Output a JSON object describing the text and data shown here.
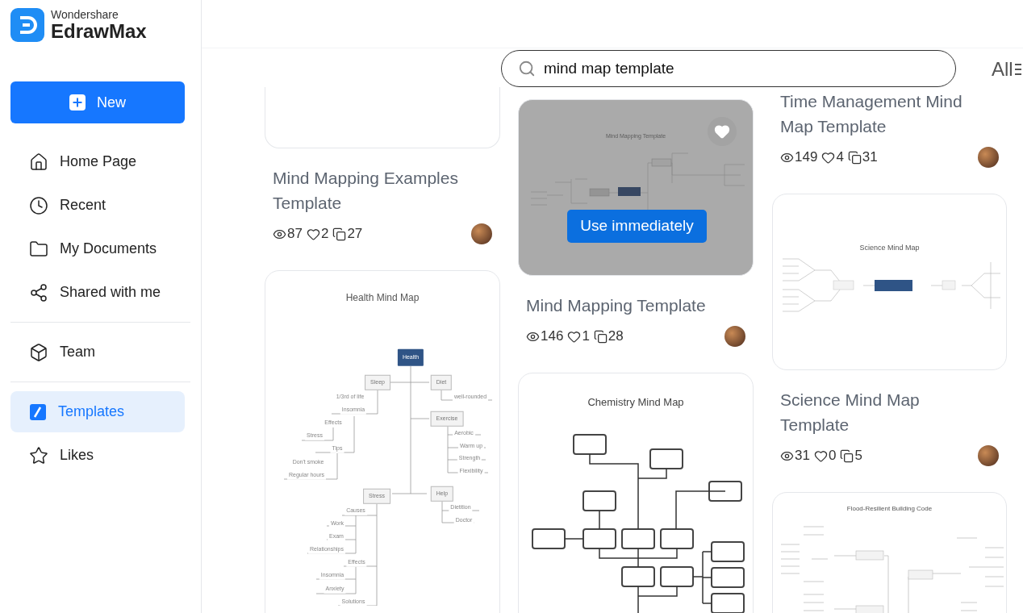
{
  "app": {
    "brand": "Wondershare",
    "product": "EdrawMax"
  },
  "sidebar": {
    "new_button": "New",
    "sections": [
      [
        {
          "label": "Home Page",
          "selected": false
        },
        {
          "label": "Recent",
          "selected": false
        },
        {
          "label": "My Documents",
          "selected": false
        },
        {
          "label": "Shared with me",
          "selected": false
        }
      ],
      [
        {
          "label": "Team",
          "selected": false
        }
      ],
      [
        {
          "label": "Templates",
          "selected": true
        },
        {
          "label": "Likes",
          "selected": false
        }
      ]
    ]
  },
  "search": {
    "value": "mind map template"
  },
  "filter": {
    "label": "All"
  },
  "columns": [
    [
      {
        "thumbnail": {
          "kind": "clipped"
        },
        "title": "Mind Mapping Examples Template",
        "views": "87",
        "likes": "2",
        "copies": "27"
      },
      {
        "thumbnail": {
          "kind": "tree",
          "title": "Health Mind Map",
          "nodes": [
            {
              "label": "Health",
              "kind": "root"
            },
            {
              "label": "Sleep",
              "kind": "box"
            },
            {
              "label": "Diet",
              "kind": "box"
            },
            {
              "label": "1/3rd of life",
              "kind": "leaf"
            },
            {
              "label": "Insomnia",
              "kind": "leaf"
            },
            {
              "label": "Effects",
              "kind": "leaf"
            },
            {
              "label": "Stress",
              "kind": "leaf"
            },
            {
              "label": "Tips",
              "kind": "leaf"
            },
            {
              "label": "Don't smoke",
              "kind": "leaf"
            },
            {
              "label": "Regular hours",
              "kind": "leaf"
            },
            {
              "label": "well-rounded",
              "kind": "leaf"
            },
            {
              "label": "Exercise",
              "kind": "box"
            },
            {
              "label": "Aerobic",
              "kind": "leaf"
            },
            {
              "label": "Warm up",
              "kind": "leaf"
            },
            {
              "label": "Strength",
              "kind": "leaf"
            },
            {
              "label": "Flexibility",
              "kind": "leaf"
            },
            {
              "label": "Stress",
              "kind": "box"
            },
            {
              "label": "Help",
              "kind": "box"
            },
            {
              "label": "Dietition",
              "kind": "leaf"
            },
            {
              "label": "Doctor",
              "kind": "leaf"
            },
            {
              "label": "Causes",
              "kind": "leaf"
            },
            {
              "label": "Work",
              "kind": "leaf"
            },
            {
              "label": "Exam",
              "kind": "leaf"
            },
            {
              "label": "Relationships",
              "kind": "leaf"
            },
            {
              "label": "Effects",
              "kind": "leaf"
            },
            {
              "label": "Insomnia",
              "kind": "leaf"
            },
            {
              "label": "Anxiety",
              "kind": "leaf"
            },
            {
              "label": "Solutions",
              "kind": "leaf"
            }
          ]
        }
      }
    ],
    [
      {
        "thumbnail": {
          "kind": "branches",
          "title": "Mind Mapping Template",
          "hovered": true,
          "action": "Use immediately"
        },
        "title": "Mind Mapping Template",
        "views": "146",
        "likes": "1",
        "copies": "28"
      },
      {
        "thumbnail": {
          "kind": "flow",
          "title": "Chemistry Mind Map"
        }
      }
    ],
    [
      {
        "title": "Time Management Mind Map Template",
        "views": "149",
        "likes": "4",
        "copies": "31"
      },
      {
        "thumbnail": {
          "kind": "radial",
          "title": "Science Mind Map"
        },
        "title": "Science Mind Map Template",
        "views": "31",
        "likes": "0",
        "copies": "5"
      },
      {
        "thumbnail": {
          "kind": "bracket",
          "title": "Flood-Resilient Building Code"
        }
      }
    ]
  ]
}
